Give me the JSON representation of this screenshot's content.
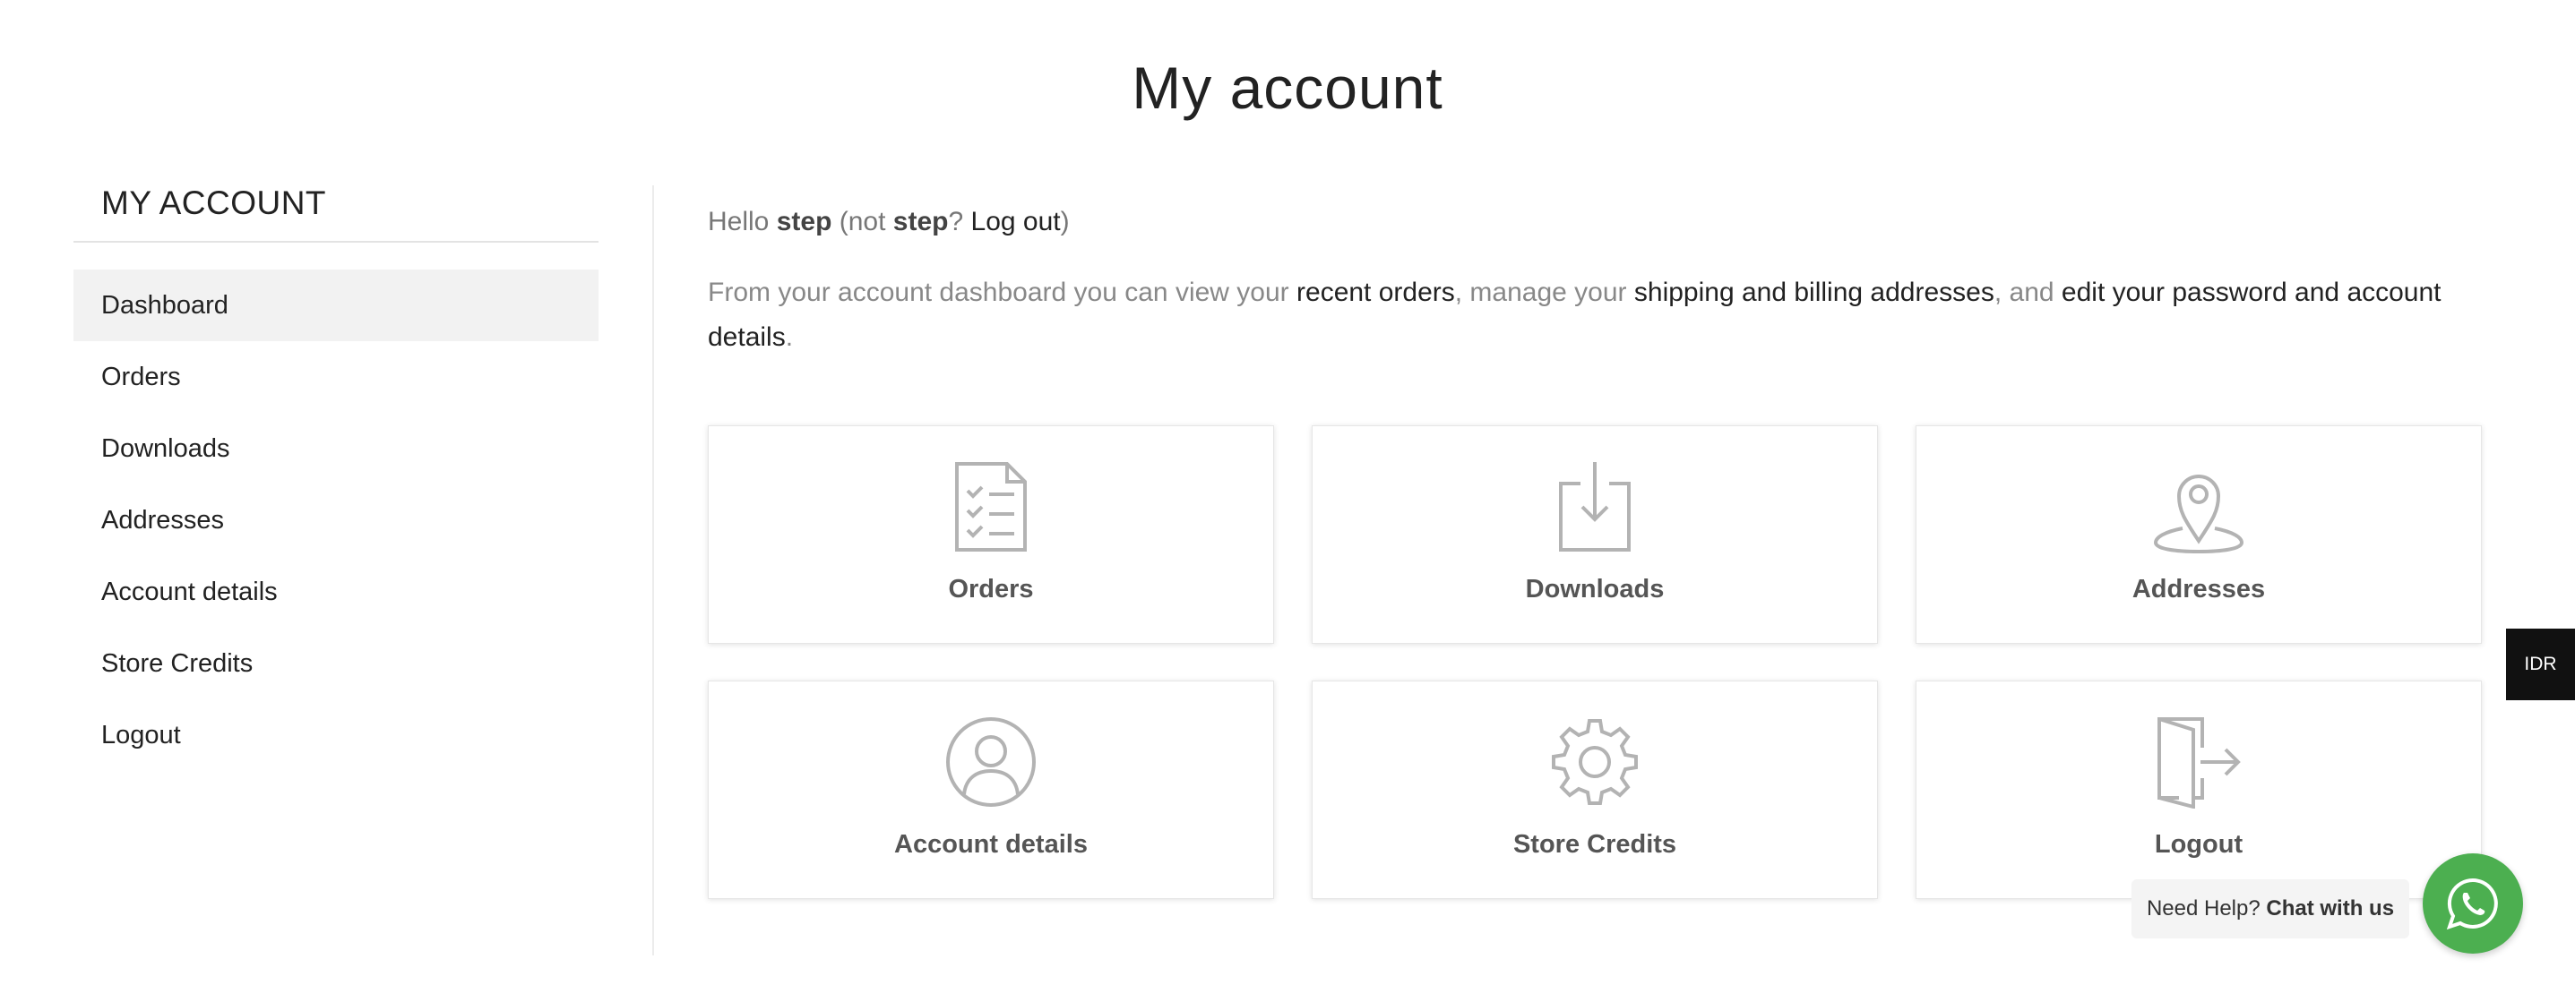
{
  "page": {
    "title": "My account"
  },
  "sidebar": {
    "heading": "MY ACCOUNT",
    "items": [
      {
        "label": "Dashboard",
        "active": true
      },
      {
        "label": "Orders"
      },
      {
        "label": "Downloads"
      },
      {
        "label": "Addresses"
      },
      {
        "label": "Account details"
      },
      {
        "label": "Store Credits"
      },
      {
        "label": "Logout"
      }
    ]
  },
  "greeting": {
    "hello": "Hello",
    "username": "step",
    "not": "(not",
    "username2": "step",
    "question": "?",
    "logout_link": "Log out",
    "close_paren": ")"
  },
  "intro": {
    "text1": "From your account dashboard you can view your",
    "link_orders": "recent orders",
    "text2": ", manage your",
    "link_addresses": "shipping and billing addresses",
    "text3": ", and",
    "link_account": "edit your password and account details",
    "text4": "."
  },
  "cards": [
    {
      "label": "Orders",
      "icon": "document-checklist-icon"
    },
    {
      "label": "Downloads",
      "icon": "download-tray-icon"
    },
    {
      "label": "Addresses",
      "icon": "map-pin-icon"
    },
    {
      "label": "Account details",
      "icon": "user-circle-icon"
    },
    {
      "label": "Store Credits",
      "icon": "gear-icon"
    },
    {
      "label": "Logout",
      "icon": "door-exit-icon"
    }
  ],
  "currency_switcher": {
    "label": "IDR"
  },
  "chat": {
    "prefix": "Need Help?",
    "action": "Chat with us"
  },
  "colors": {
    "icon_gray": "#b3b3b3",
    "whatsapp_green": "#4caf50",
    "active_bg": "#f2f2f2"
  }
}
